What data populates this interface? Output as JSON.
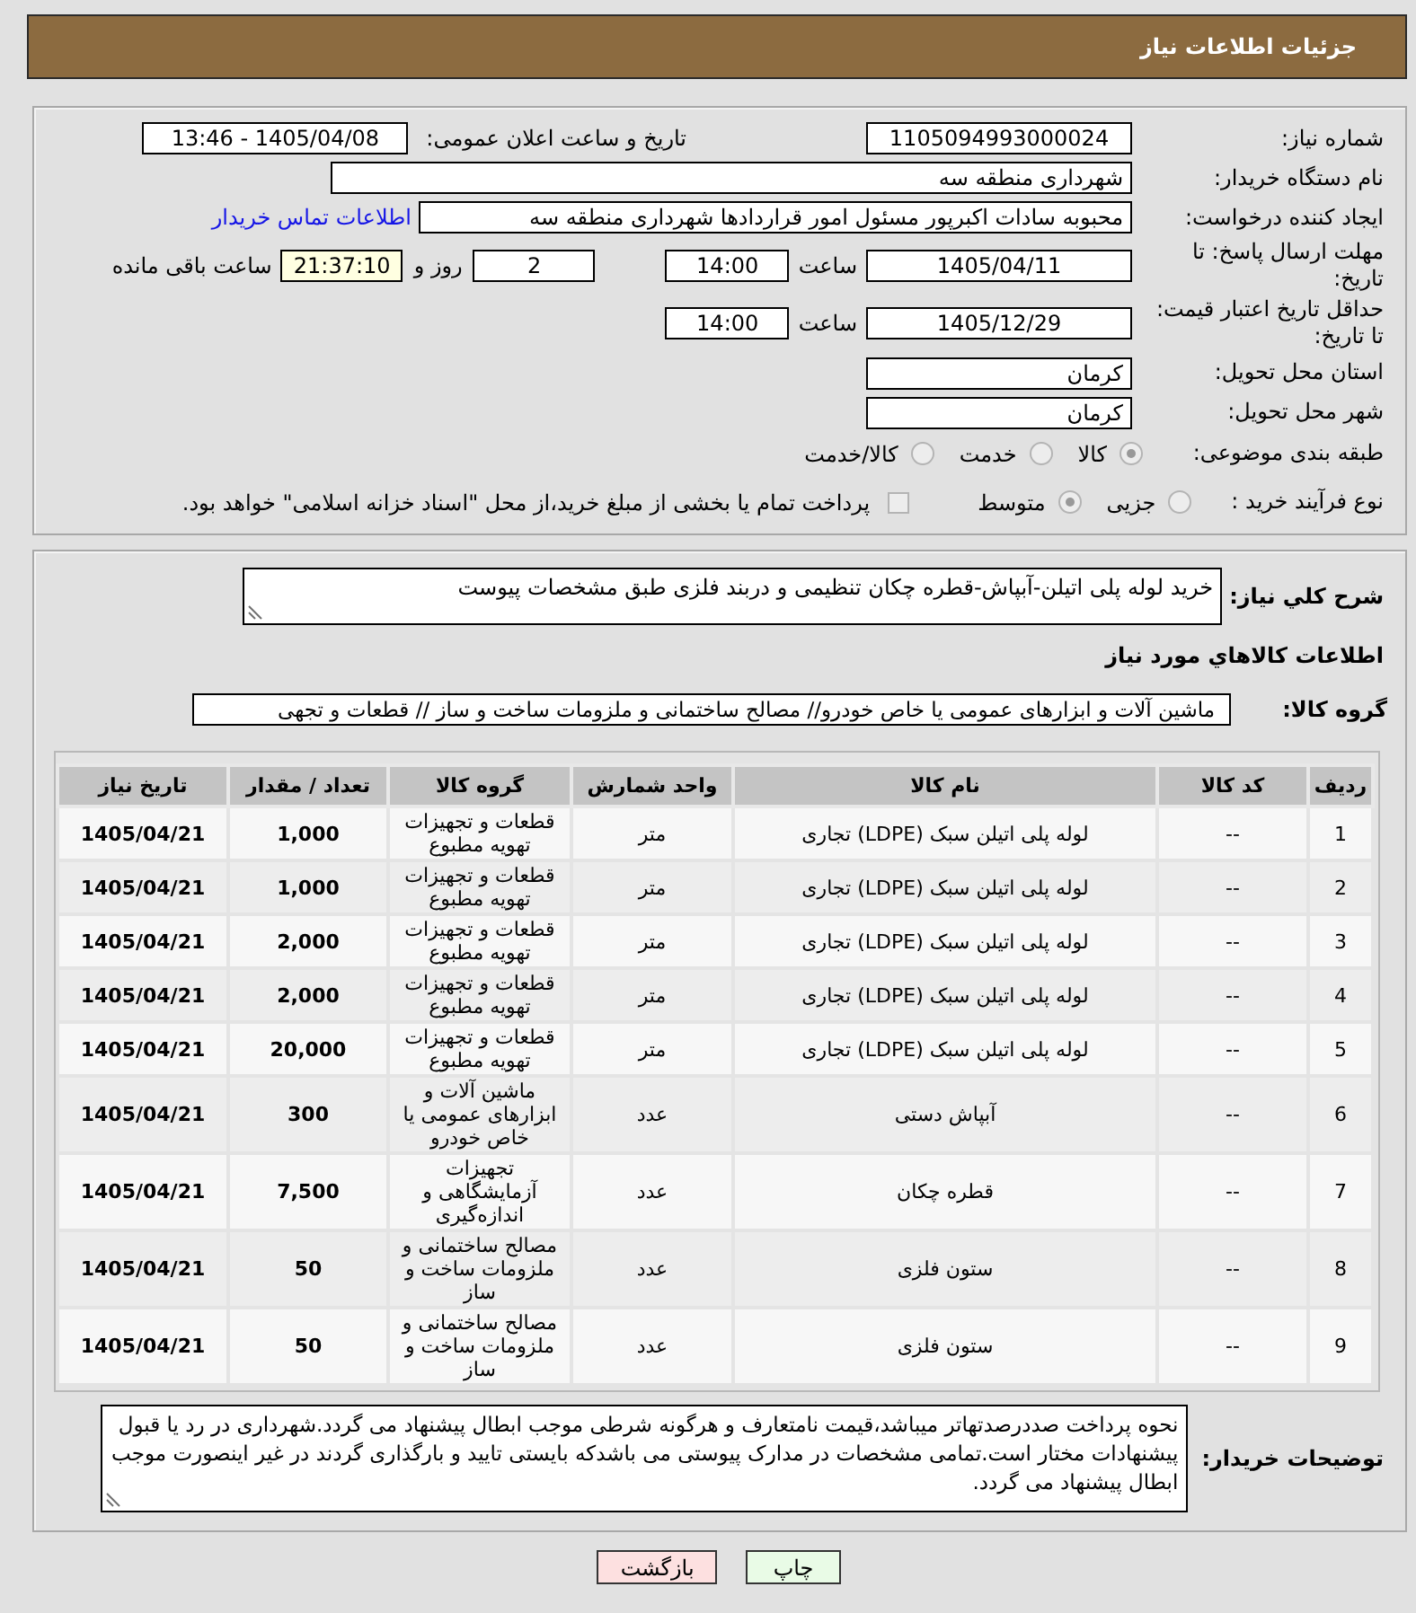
{
  "header": {
    "title": "جزئیات اطلاعات نیاز"
  },
  "need_number": {
    "label": "شماره نیاز:",
    "value": "1105094993000024"
  },
  "announce_datetime": {
    "label": "تاریخ و ساعت اعلان عمومی:",
    "value": "1405/04/08 - 13:46"
  },
  "buyer_org": {
    "label": "نام دستگاه خریدار:",
    "value": "شهرداری منطقه سه"
  },
  "requester": {
    "label": "ایجاد کننده درخواست:",
    "value": "محبوبه سادات اکبرپور مسئول امور قراردادها شهرداری منطقه سه",
    "link": "اطلاعات تماس خریدار"
  },
  "reply_deadline": {
    "label": "مهلت ارسال پاسخ: تا تاریخ:",
    "date": "1405/04/11",
    "time_label": "ساعت",
    "time": "14:00",
    "days": "2",
    "days_label": "روز و",
    "remaining": "21:37:10",
    "remaining_label": "ساعت باقی مانده"
  },
  "price_validity": {
    "label": "حداقل تاریخ اعتبار قیمت: تا تاریخ:",
    "date": "1405/12/29",
    "time_label": "ساعت",
    "time": "14:00"
  },
  "delivery_province": {
    "label": "استان محل تحویل:",
    "value": "کرمان"
  },
  "delivery_city": {
    "label": "شهر محل تحویل:",
    "value": "کرمان"
  },
  "subject_category": {
    "label": "طبقه بندی موضوعی:",
    "disabled": true,
    "options": [
      {
        "label": "کالا",
        "selected": true
      },
      {
        "label": "خدمت",
        "selected": false
      },
      {
        "label": "کالا/خدمت",
        "selected": false
      }
    ]
  },
  "purchase_process": {
    "label": "نوع فرآیند خرید :",
    "disabled": true,
    "options": [
      {
        "label": "جزیی",
        "selected": false
      },
      {
        "label": "متوسط",
        "selected": true
      }
    ],
    "treasury_checkbox": {
      "label": "پرداخت تمام یا بخشی از مبلغ خرید،از محل \"اسناد خزانه اسلامی\" خواهد بود.",
      "checked": false,
      "disabled": true
    }
  },
  "description": {
    "label": "شرح کلي نیاز:",
    "value": "خرید لوله پلی اتیلن-آبپاش-قطره چکان تنظیمی و دربند فلزی طبق مشخصات پیوست"
  },
  "items_title": "اطلاعات کالاهاي مورد نیاز",
  "goods_group": {
    "label": "گروه کالا:",
    "value": "ماشین آلات و ابزارهای عمومی یا خاص خودرو// مصالح ساختمانی و ملزومات ساخت و ساز //  قطعات و تجهی"
  },
  "items_table": {
    "columns": [
      "ردیف",
      "کد کالا",
      "نام کالا",
      "واحد شمارش",
      "گروه کالا",
      "تعداد / مقدار",
      "تاریخ نیاز"
    ],
    "rows": [
      [
        "1",
        "--",
        "لوله پلی اتیلن سبک (LDPE) تجاری",
        "متر",
        "قطعات و تجهیزات تهویه مطبوع",
        "1,000",
        "1405/04/21"
      ],
      [
        "2",
        "--",
        "لوله پلی اتیلن سبک (LDPE) تجاری",
        "متر",
        "قطعات و تجهیزات تهویه مطبوع",
        "1,000",
        "1405/04/21"
      ],
      [
        "3",
        "--",
        "لوله پلی اتیلن سبک (LDPE) تجاری",
        "متر",
        "قطعات و تجهیزات تهویه مطبوع",
        "2,000",
        "1405/04/21"
      ],
      [
        "4",
        "--",
        "لوله پلی اتیلن سبک (LDPE) تجاری",
        "متر",
        "قطعات و تجهیزات تهویه مطبوع",
        "2,000",
        "1405/04/21"
      ],
      [
        "5",
        "--",
        "لوله پلی اتیلن سبک (LDPE) تجاری",
        "متر",
        "قطعات و تجهیزات تهویه مطبوع",
        "20,000",
        "1405/04/21"
      ],
      [
        "6",
        "--",
        "آبپاش دستی",
        "عدد",
        "ماشین آلات و ابزارهای عمومی یا خاص خودرو",
        "300",
        "1405/04/21"
      ],
      [
        "7",
        "--",
        "قطره چکان",
        "عدد",
        "تجهیزات آزمایشگاهی و اندازه‌گیری",
        "7,500",
        "1405/04/21"
      ],
      [
        "8",
        "--",
        "ستون فلزی",
        "عدد",
        "مصالح ساختمانی و ملزومات ساخت و ساز",
        "50",
        "1405/04/21"
      ],
      [
        "9",
        "--",
        "ستون فلزی",
        "عدد",
        "مصالح ساختمانی و ملزومات ساخت و ساز",
        "50",
        "1405/04/21"
      ]
    ]
  },
  "buyer_notes": {
    "label": "توضیحات خریدار:",
    "value": "نحوه پرداخت صددرصدتهاتر میباشد،قیمت نامتعارف و هرگونه شرطی موجب ابطال پیشنهاد می گردد.شهرداری در رد یا قبول پیشنهادات مختار است.تمامی مشخصات در مدارک پیوستی می باشدکه بایستی تایید و بارگذاری گردند در غیر اینصورت موجب ابطال پیشنهاد می گردد."
  },
  "buttons": [
    {
      "label": "چاپ",
      "kind": "print"
    },
    {
      "label": "بازگشت",
      "kind": "back"
    }
  ]
}
